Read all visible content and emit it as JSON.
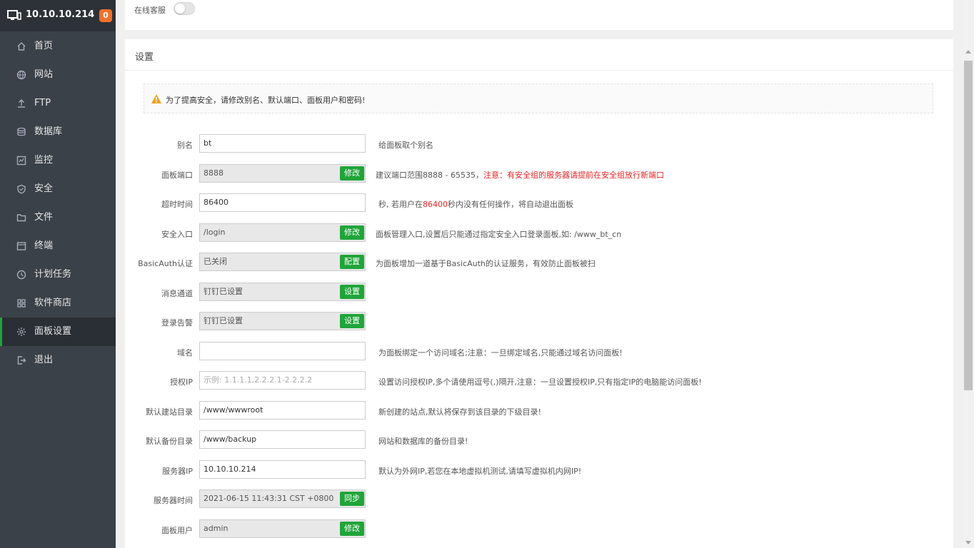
{
  "sidebar": {
    "ip": "10.10.10.214",
    "badge": "0",
    "items": [
      {
        "label": "首页",
        "icon": "home-icon"
      },
      {
        "label": "网站",
        "icon": "globe-icon"
      },
      {
        "label": "FTP",
        "icon": "upload-icon"
      },
      {
        "label": "数据库",
        "icon": "database-icon"
      },
      {
        "label": "监控",
        "icon": "monitor-icon"
      },
      {
        "label": "安全",
        "icon": "shield-icon"
      },
      {
        "label": "文件",
        "icon": "folder-icon"
      },
      {
        "label": "终端",
        "icon": "terminal-icon"
      },
      {
        "label": "计划任务",
        "icon": "clock-icon"
      },
      {
        "label": "软件商店",
        "icon": "grid-icon"
      },
      {
        "label": "面板设置",
        "icon": "gear-icon",
        "active": true
      },
      {
        "label": "退出",
        "icon": "exit-icon"
      }
    ]
  },
  "top": {
    "online_service_label": "在线客服",
    "toggle_on": false
  },
  "settings": {
    "title": "设置",
    "warning": "为了提高安全，请修改别名、默认端口、面板用户和密码!",
    "alias": {
      "label": "别名",
      "value": "bt",
      "desc": "给面板取个别名"
    },
    "port": {
      "label": "面板端口",
      "value": "8888",
      "btn": "修改",
      "desc": "建议端口范围8888 - 65535，",
      "desc_red": "注意：有安全组的服务器请提前在安全组放行新端口"
    },
    "timeout": {
      "label": "超时时间",
      "value": "86400",
      "desc_pre": "秒, 若用户在",
      "desc_red": "86400",
      "desc_post": "秒内没有任何操作，将自动退出面板"
    },
    "entry": {
      "label": "安全入口",
      "value": "/login",
      "btn": "修改",
      "desc": "面板管理入口,设置后只能通过指定安全入口登录面板,如: /www_bt_cn"
    },
    "basicauth": {
      "label": "BasicAuth认证",
      "value": "已关闭",
      "btn": "配置",
      "desc": "为面板增加一道基于BasicAuth的认证服务，有效防止面板被扫"
    },
    "msg_channel": {
      "label": "消息通道",
      "value": "钉钉已设置",
      "btn": "设置"
    },
    "login_alert": {
      "label": "登录告警",
      "value": "钉钉已设置",
      "btn": "设置"
    },
    "domain": {
      "label": "域名",
      "value": "",
      "desc": "为面板绑定一个访问域名;注意：一旦绑定域名,只能通过域名访问面板!"
    },
    "auth_ip": {
      "label": "授权IP",
      "placeholder": "示例: 1.1.1.1,2.2.2.1-2.2.2.2",
      "desc": "设置访问授权IP,多个请使用逗号(,)隔开,注意：一旦设置授权IP,只有指定IP的电脑能访问面板!"
    },
    "site_dir": {
      "label": "默认建站目录",
      "value": "/www/wwwroot",
      "desc": "新创建的站点,默认将保存到该目录的下级目录!"
    },
    "backup_dir": {
      "label": "默认备份目录",
      "value": "/www/backup",
      "desc": "网站和数据库的备份目录!"
    },
    "server_ip": {
      "label": "服务器IP",
      "value": "10.10.10.214",
      "desc": "默认为外网IP,若您在本地虚拟机测试,请填写虚拟机内网IP!"
    },
    "server_time": {
      "label": "服务器时间",
      "value": "2021-06-15 11:43:31 CST +0800",
      "btn": "同步"
    },
    "panel_user": {
      "label": "面板用户",
      "value": "admin",
      "btn": "修改"
    }
  },
  "colors": {
    "accent": "#20a53a",
    "sidebar": "#3a4148",
    "badge": "#f2702a",
    "warn": "#f0a020"
  }
}
